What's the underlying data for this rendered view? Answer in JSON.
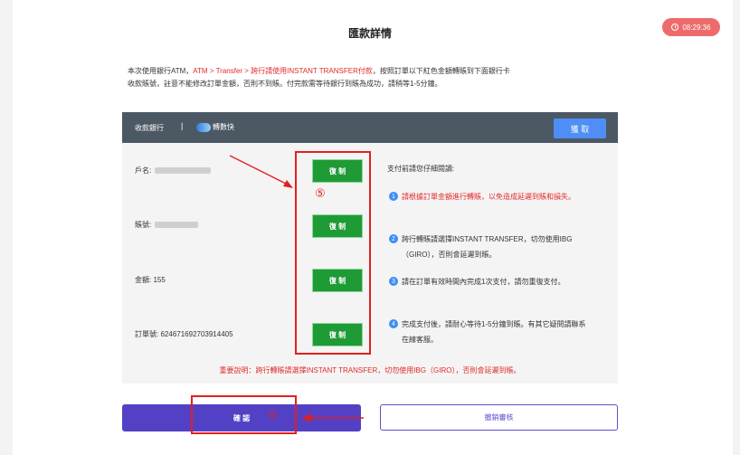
{
  "page": {
    "title": "匯款詳情"
  },
  "timer": {
    "value": "08:29:36",
    "icon": "clock-icon"
  },
  "notice": {
    "line1_before": "本次使用銀行ATM，",
    "line1_red": "ATM > Transfer > 跨行請使用INSTANT TRANSFER付款",
    "line1_after": "，按照訂單以下紅色金額轉賬到下面銀行卡",
    "line2": "收款賬號，註意不能修改訂單金額，否則不到賬。付完款需等待銀行到賬為成功，請稍等1-5分鐘。"
  },
  "panel": {
    "bank_label": "收款銀行",
    "separator": "|",
    "bank_name": "轉數快",
    "get_button": "獲 取",
    "account_name_label": "戶名:",
    "account_number_label": "賬號:",
    "amount_label": "金額:",
    "amount_value": "155",
    "order_label": "訂單號:",
    "order_value": "624671692703914405",
    "copy_label": "復 制",
    "tips_title": "支付前請您仔細閱讀:",
    "tips": [
      {
        "num": "1",
        "text": "請根據訂單金額進行轉賬，以免造成延遲到賬和損失。"
      },
      {
        "num": "2",
        "text": "跨行轉賬請選擇INSTANT TRANSFER，切勿使用IBG（GIRO），否則會延遲到賬。"
      },
      {
        "num": "3",
        "text": "請在訂單有效時間內完成1次支付，請勿重復支付。"
      },
      {
        "num": "4",
        "text": "完成支付後，請耐心等待1-5分鐘到賬。有其它疑問請聯系在線客服。"
      }
    ],
    "important": "重要說明：跨行轉賬請選擇INSTANT TRANSFER，切勿使用IBG（GIRO），否則會延遲到賬。"
  },
  "annotations": {
    "step5": "⑤",
    "step6": "⑥"
  },
  "actions": {
    "confirm": "確 認",
    "cancel": "撤銷審核"
  },
  "colors": {
    "accent": "#5341c5",
    "copy": "#1f9b35",
    "alert": "#e32b2b",
    "header": "#4d5865",
    "timer": "#ee6b6b"
  }
}
